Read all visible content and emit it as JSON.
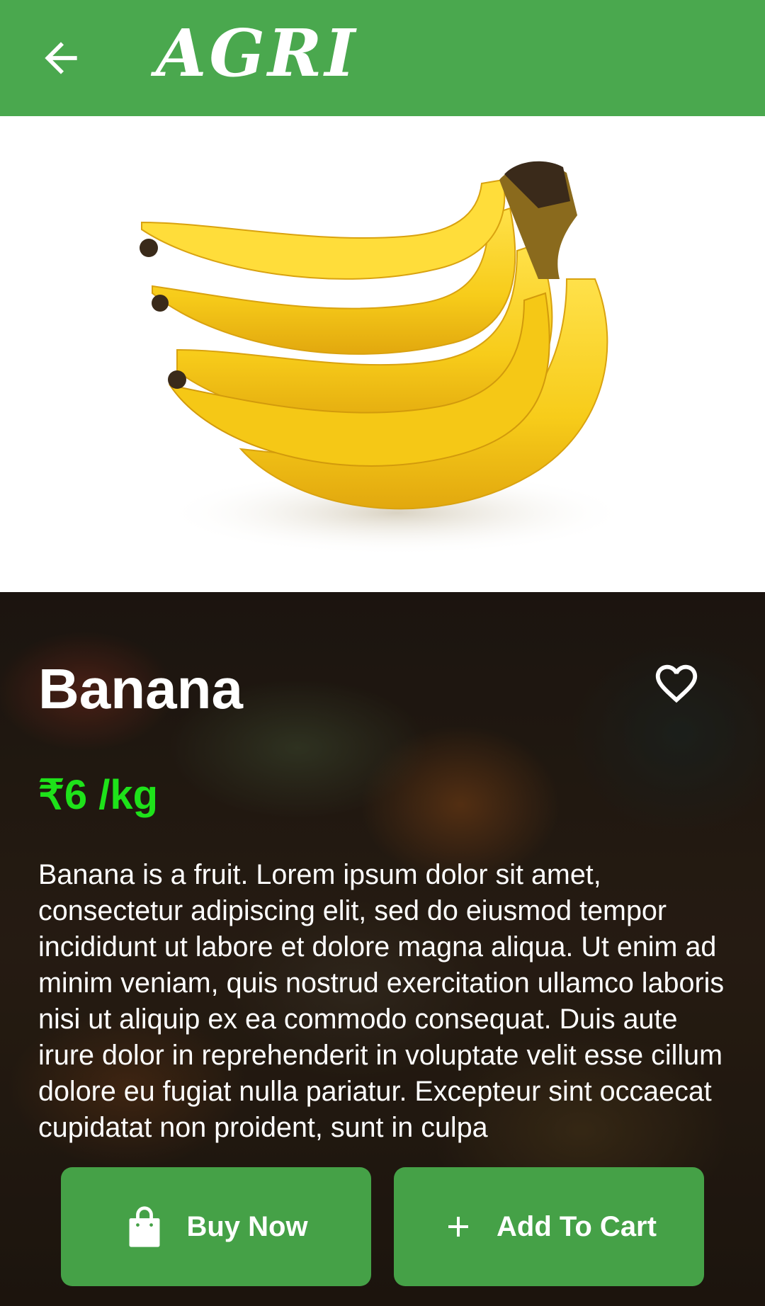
{
  "appbar": {
    "logo_text": "AGRI",
    "back_icon": "arrow-back-icon"
  },
  "product": {
    "name": "Banana",
    "price": "₹6 /kg",
    "description": "Banana is a fruit. Lorem ipsum dolor sit amet, consectetur adipiscing elit, sed do eiusmod tempor incididunt ut labore et dolore magna aliqua. Ut enim ad minim veniam, quis nostrud exercitation ullamco laboris nisi ut aliquip ex ea commodo consequat. Duis aute irure dolor in reprehenderit in voluptate velit esse cillum dolore eu fugiat nulla pariatur. Excepteur sint occaecat cupidatat non proident, sunt in culpa",
    "favorite_icon": "heart-outline-icon"
  },
  "actions": {
    "buy_now_label": "Buy Now",
    "buy_now_icon": "shopping-bag-icon",
    "add_to_cart_label": "Add To Cart",
    "add_to_cart_icon": "plus-icon"
  },
  "colors": {
    "primary": "#4aa84e",
    "button": "#45a147",
    "price": "#1ee21a"
  }
}
